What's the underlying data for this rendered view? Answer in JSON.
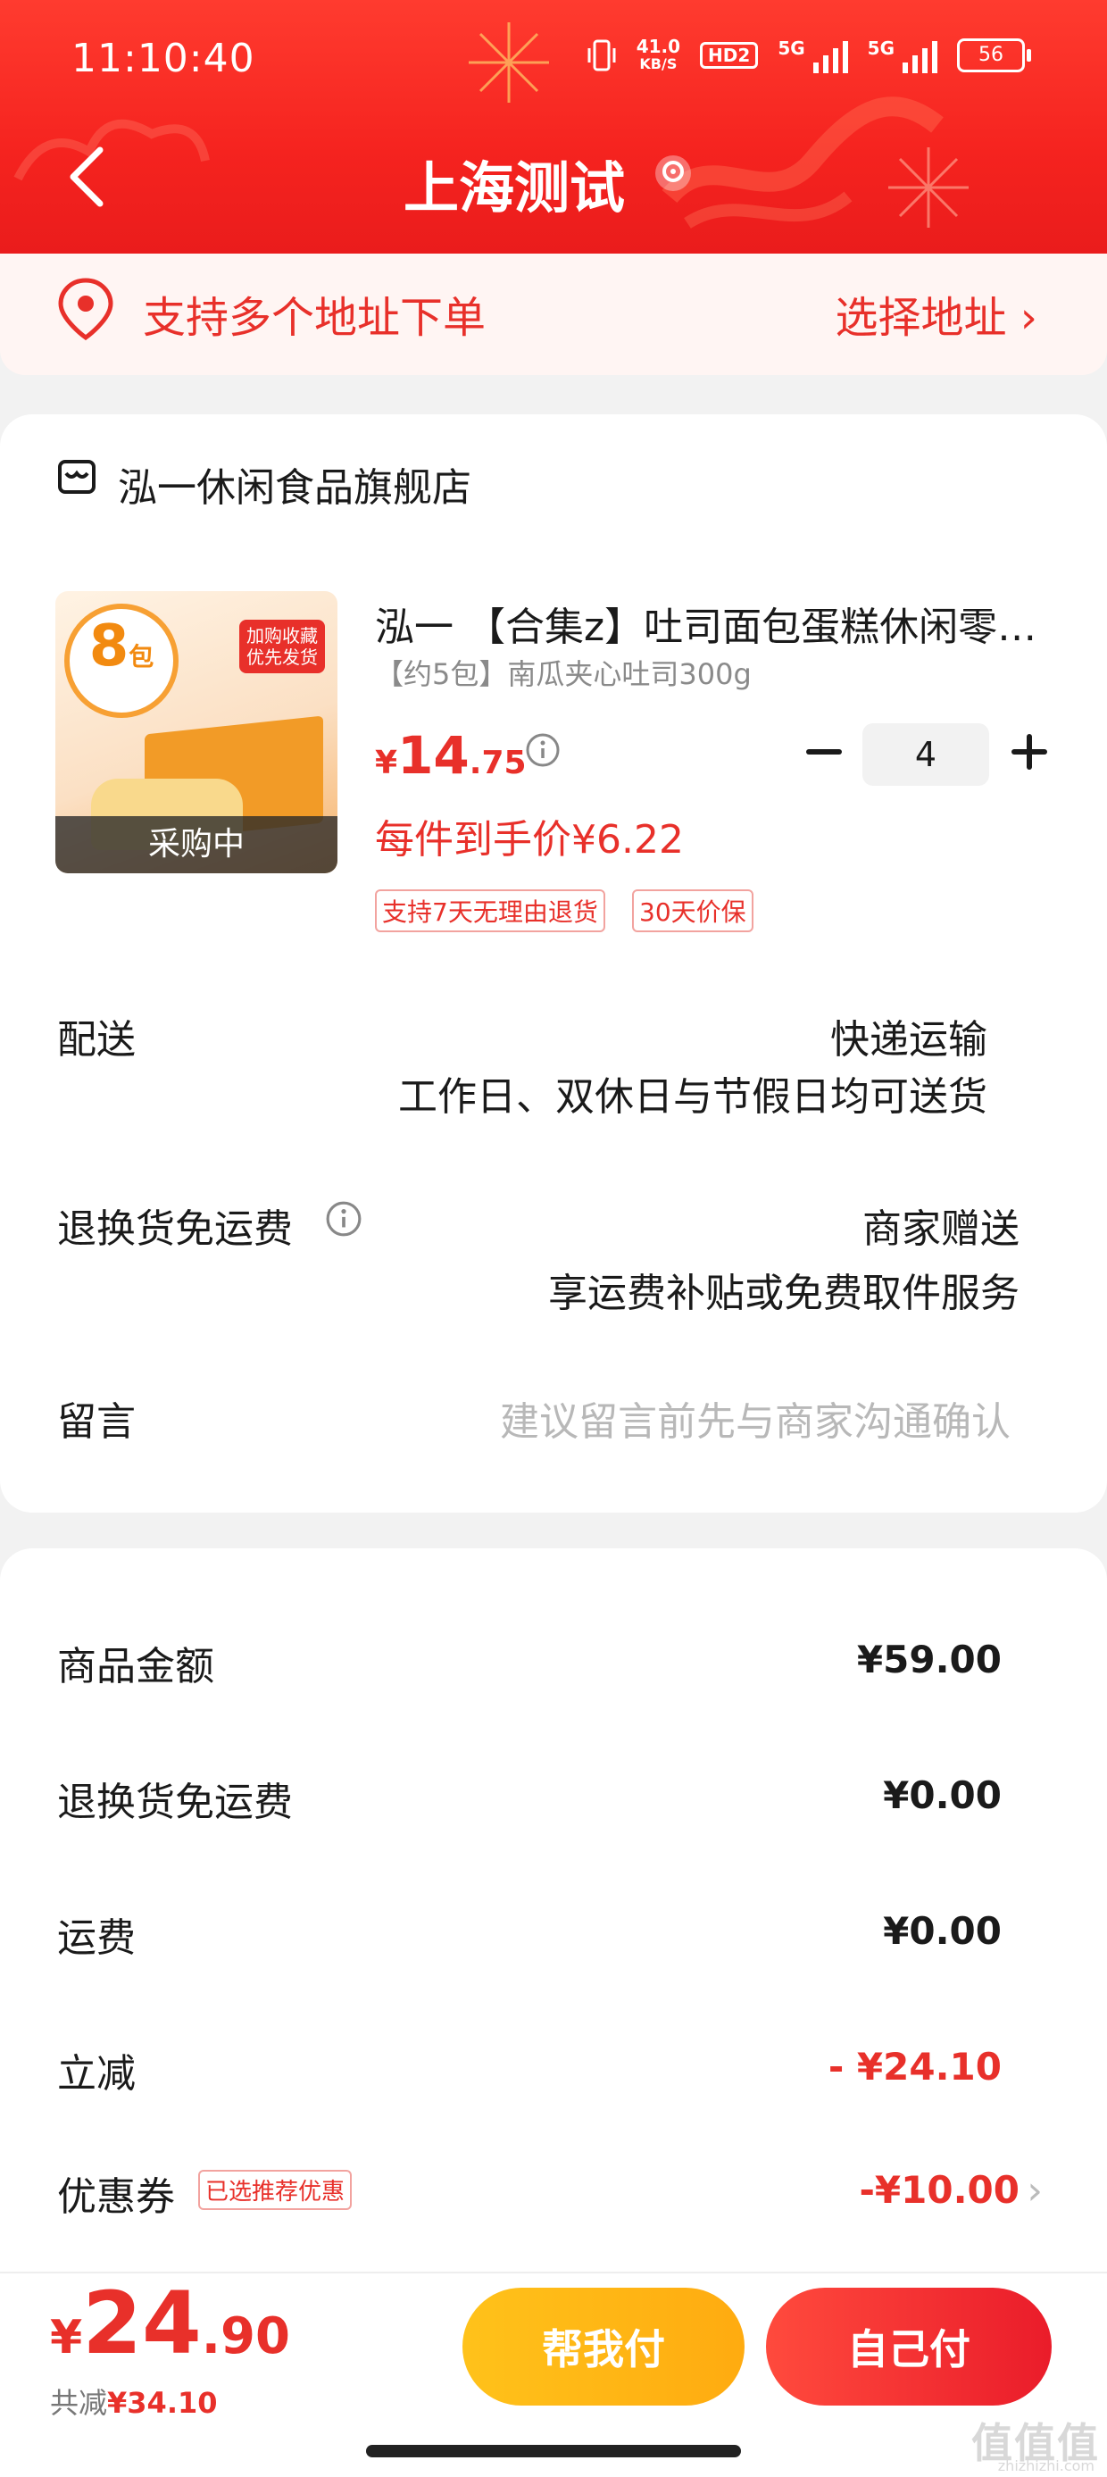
{
  "status_bar": {
    "time": "11:10:40",
    "net_speed": "41.0",
    "net_unit": "KB/S",
    "hd": "HD2",
    "sig1": "5G",
    "sig2": "5G",
    "battery": "56"
  },
  "header": {
    "title": "上海测试"
  },
  "address": {
    "text": "支持多个地址下单",
    "select_label": "选择地址 ›"
  },
  "store": {
    "name": "泓一休闲食品旗舰店"
  },
  "product": {
    "title": "泓一 【合集z】吐司面包蛋糕休闲零…",
    "sku": "【约5包】南瓜夹心吐司300g",
    "price_currency": "¥",
    "price_int": "14",
    "price_dec": ".75",
    "quantity": "4",
    "unit_price": "每件到手价¥6.22",
    "status": "采购中",
    "image_badge_num": "8",
    "image_badge_unit": "包",
    "image_tag_line1": "加购收藏",
    "image_tag_line2": "优先发货",
    "service_tags": [
      "支持7天无理由退货",
      "30天价保"
    ]
  },
  "delivery": {
    "label": "配送",
    "method": "快递运输",
    "schedule": "工作日、双休日与节假日均可送货"
  },
  "return_shipping": {
    "label": "退换货免运费",
    "value": "商家赠送",
    "detail": "享运费补贴或免费取件服务"
  },
  "remark": {
    "label": "留言",
    "placeholder": "建议留言前先与商家沟通确认"
  },
  "summary": {
    "goods_label": "商品金额",
    "goods_value": "¥59.00",
    "return_label": "退换货免运费",
    "return_value": "¥0.00",
    "shipping_label": "运费",
    "shipping_value": "¥0.00",
    "discount_label": "立减",
    "discount_value": "- ¥24.10",
    "coupon_label": "优惠券",
    "coupon_tag": "已选推荐优惠",
    "coupon_value": "-¥10.00"
  },
  "footer": {
    "total_currency": "¥",
    "total_int": "24",
    "total_dec": ".90",
    "saved_prefix": "共减",
    "saved_value": "¥34.10",
    "help_pay": "帮我付",
    "self_pay": "自己付"
  },
  "watermark": {
    "main": "值值值",
    "sub": "zhizhizhi.com"
  },
  "colors": {
    "brand_red": "#e8302a",
    "header_red": "#f5231f",
    "help_yellow": "#ffb514"
  }
}
